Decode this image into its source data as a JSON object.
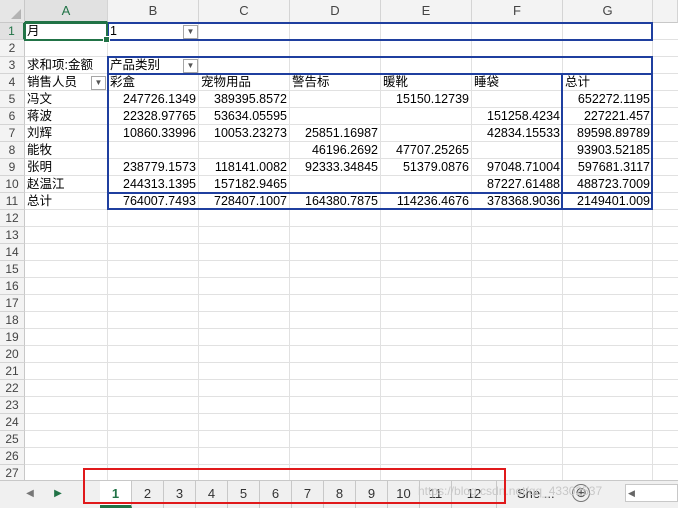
{
  "columns": [
    "A",
    "B",
    "C",
    "D",
    "E",
    "F",
    "G"
  ],
  "rows": [
    "1",
    "2",
    "3",
    "4",
    "5",
    "6",
    "7",
    "8",
    "9",
    "10",
    "11",
    "12",
    "13",
    "14",
    "15",
    "16",
    "17",
    "18",
    "19",
    "20",
    "21",
    "22",
    "23",
    "24",
    "25",
    "26",
    "27"
  ],
  "filter": {
    "label": "月",
    "value": "1"
  },
  "pivot": {
    "values_label": "求和项:金额",
    "col_field": "产品类别",
    "row_field": "销售人员",
    "categories": [
      "彩盒",
      "宠物用品",
      "警告标",
      "暖靴",
      "睡袋",
      "总计"
    ],
    "rows": [
      {
        "name": "冯文",
        "cells": [
          "247726.1349",
          "389395.8572",
          "",
          "15150.12739",
          "",
          "652272.1195"
        ]
      },
      {
        "name": "蒋波",
        "cells": [
          "22328.97765",
          "53634.05595",
          "",
          "",
          "151258.4234",
          "227221.457"
        ]
      },
      {
        "name": "刘辉",
        "cells": [
          "10860.33996",
          "10053.23273",
          "25851.16987",
          "",
          "42834.15533",
          "89598.89789"
        ]
      },
      {
        "name": "能牧",
        "cells": [
          "",
          "",
          "46196.2692",
          "47707.25265",
          "",
          "93903.52185"
        ]
      },
      {
        "name": "张明",
        "cells": [
          "238779.1573",
          "118141.0082",
          "92333.34845",
          "51379.0876",
          "97048.71004",
          "597681.3117"
        ]
      },
      {
        "name": "赵温江",
        "cells": [
          "244313.1395",
          "157182.9465",
          "",
          "",
          "87227.61488",
          "488723.7009"
        ]
      },
      {
        "name": "总计",
        "cells": [
          "764007.7493",
          "728407.1007",
          "164380.7875",
          "114236.4676",
          "378368.9036",
          "2149401.009"
        ]
      }
    ]
  },
  "sheet_tabs": [
    "1",
    "2",
    "3",
    "4",
    "5",
    "6",
    "7",
    "8",
    "9",
    "10",
    "11",
    "12"
  ],
  "active_tab": "1",
  "more_sheets_label": "She ...",
  "add_sheet_symbol": "⊕",
  "watermark": "https://blog.csdn.net/qq_43302537",
  "colors": {
    "pivot_border": "#1f3f9f",
    "selection": "#217346",
    "highlight_box": "#e0191b"
  }
}
